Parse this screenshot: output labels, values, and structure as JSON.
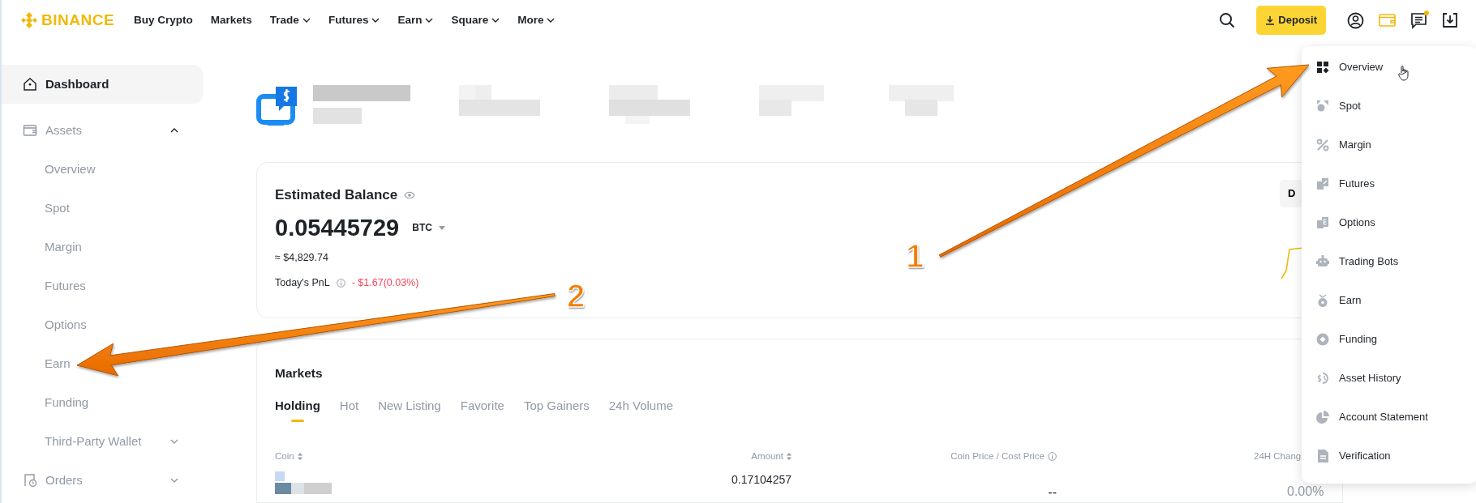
{
  "brand": {
    "name": "BINANCE"
  },
  "nav": [
    {
      "label": "Buy Crypto",
      "has_menu": false
    },
    {
      "label": "Markets",
      "has_menu": false
    },
    {
      "label": "Trade",
      "has_menu": true
    },
    {
      "label": "Futures",
      "has_menu": true
    },
    {
      "label": "Earn",
      "has_menu": true
    },
    {
      "label": "Square",
      "has_menu": true
    },
    {
      "label": "More",
      "has_menu": true
    }
  ],
  "header_actions": {
    "deposit": "Deposit",
    "notification_dot": true
  },
  "sidebar": [
    {
      "label": "Dashboard",
      "kind": "home",
      "selected": true
    },
    {
      "label": "Assets",
      "kind": "wallet",
      "selected": false,
      "expanded": true,
      "children": [
        {
          "label": "Overview"
        },
        {
          "label": "Spot"
        },
        {
          "label": "Margin"
        },
        {
          "label": "Futures"
        },
        {
          "label": "Options"
        },
        {
          "label": "Earn"
        },
        {
          "label": "Funding"
        },
        {
          "label": "Third-Party Wallet",
          "expanded": false
        }
      ]
    },
    {
      "label": "Orders",
      "kind": "orders",
      "selected": false,
      "expanded": false
    }
  ],
  "balance": {
    "title": "Estimated Balance",
    "amount": "0.05445729",
    "unit": "BTC",
    "fiat": "≈ $4,829.74",
    "pnl_label": "Today's PnL",
    "pnl_value": "- $1.67(0.03%)",
    "side_button": "D"
  },
  "markets": {
    "title": "Markets",
    "tabs": [
      {
        "label": "Holding",
        "selected": true
      },
      {
        "label": "Hot",
        "selected": false
      },
      {
        "label": "New Listing",
        "selected": false
      },
      {
        "label": "Favorite",
        "selected": false
      },
      {
        "label": "Top Gainers",
        "selected": false
      },
      {
        "label": "24h Volume",
        "selected": false
      }
    ],
    "columns": [
      {
        "label": "Coin",
        "sortable": true,
        "info": false
      },
      {
        "label": "Amount",
        "sortable": true,
        "info": false
      },
      {
        "label": "Coin Price / Cost Price",
        "sortable": false,
        "info": true
      },
      {
        "label": "24H Chang"
      }
    ],
    "rows": [
      {
        "amount": "0.17104257",
        "price": "--",
        "change": "0.00%"
      }
    ]
  },
  "assets_menu": [
    {
      "label": "Overview",
      "selected": true
    },
    {
      "label": "Spot",
      "selected": false
    },
    {
      "label": "Margin",
      "selected": false
    },
    {
      "label": "Futures",
      "selected": false
    },
    {
      "label": "Options",
      "selected": false
    },
    {
      "label": "Trading Bots",
      "selected": false
    },
    {
      "label": "Earn",
      "selected": false
    },
    {
      "label": "Funding",
      "selected": false
    },
    {
      "label": "Asset History",
      "selected": false
    },
    {
      "label": "Account Statement",
      "selected": false
    },
    {
      "label": "Verification",
      "selected": false
    }
  ],
  "annotations": [
    {
      "label": "1"
    },
    {
      "label": "2"
    }
  ]
}
